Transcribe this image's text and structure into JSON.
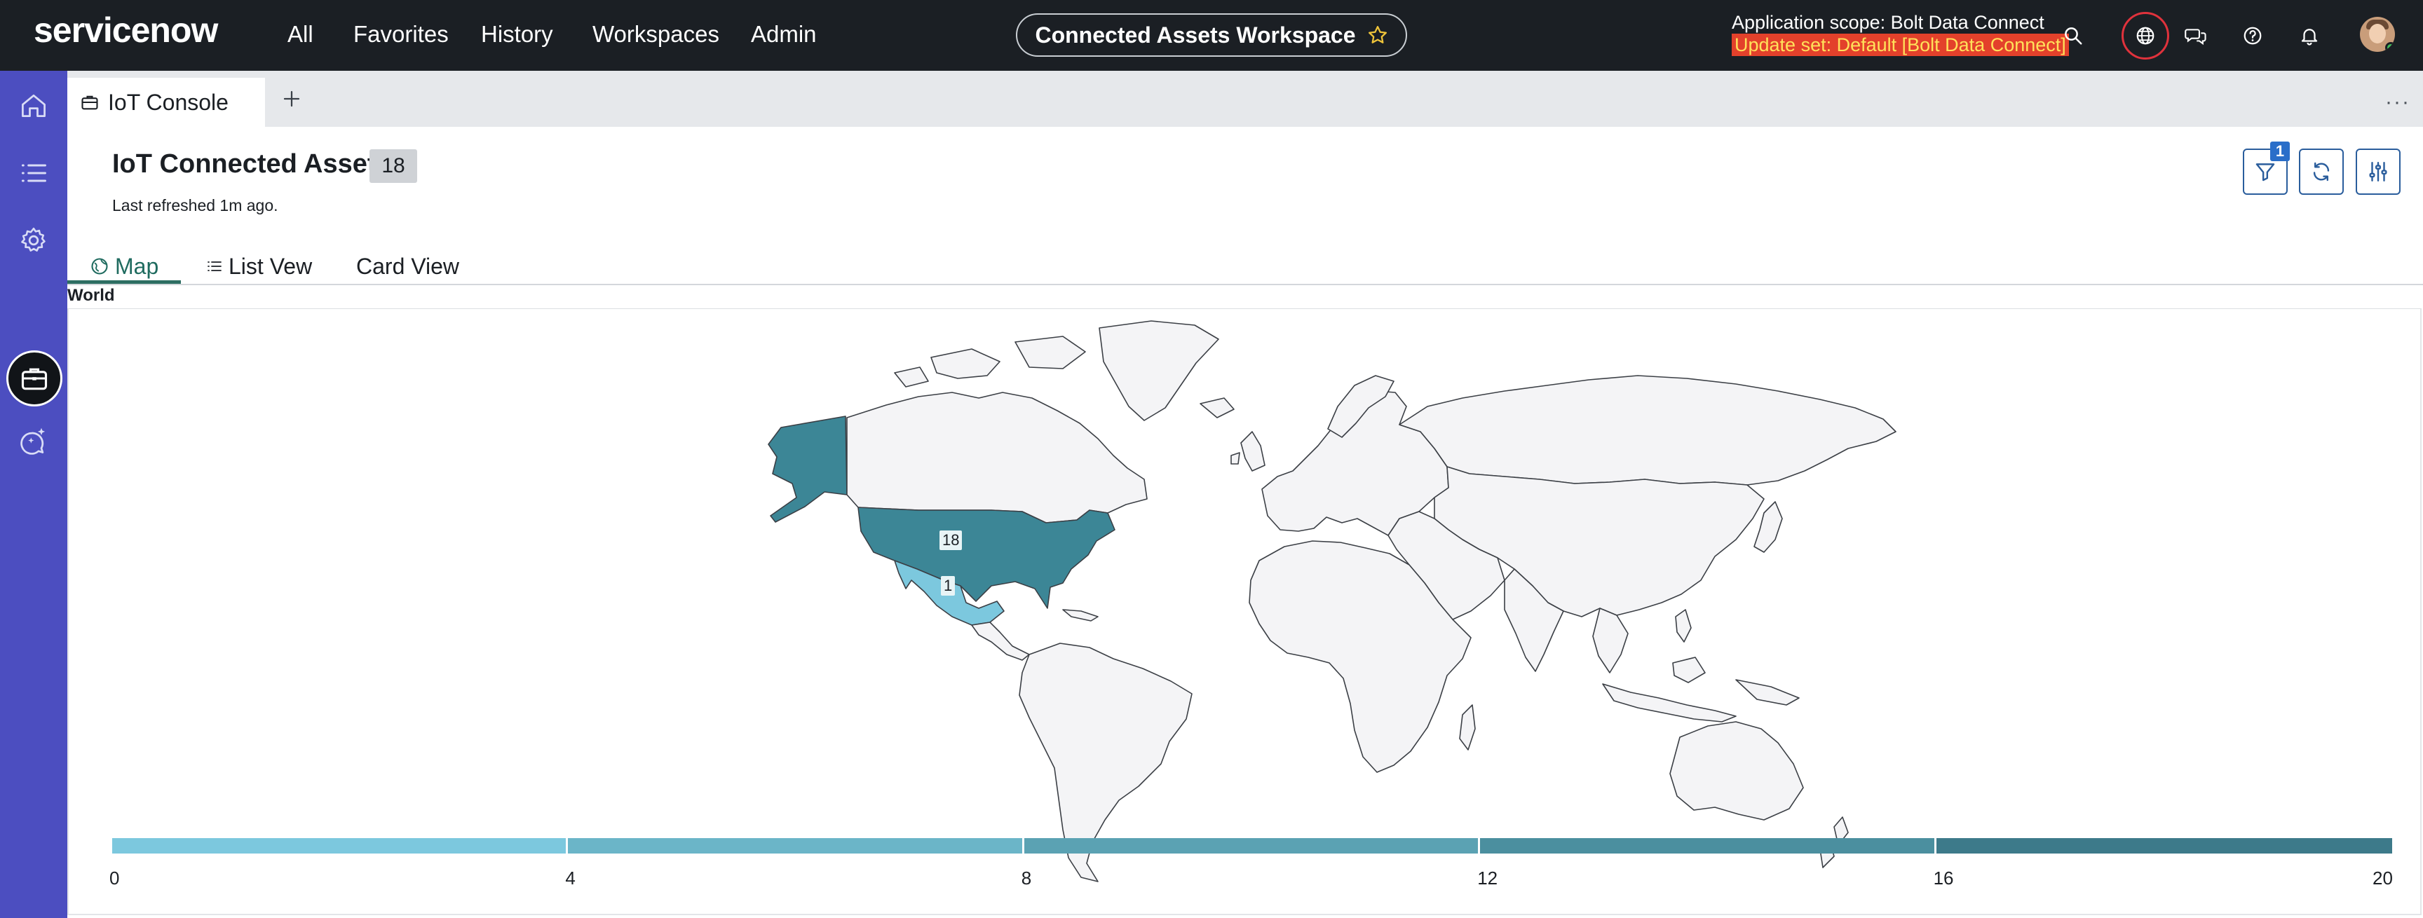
{
  "topbar": {
    "logo_text": "servicenow",
    "nav": [
      "All",
      "Favorites",
      "History",
      "Workspaces",
      "Admin"
    ],
    "workspace_title": "Connected Assets Workspace",
    "scope_line": "Application scope: Bolt Data Connect",
    "update_set_line": "Update set: Default [Bolt Data Connect]",
    "icons": [
      "search-icon",
      "globe-icon",
      "chat-icon",
      "help-icon",
      "bell-icon",
      "avatar"
    ]
  },
  "rail": {
    "icons": [
      "home-icon",
      "list-icon",
      "gear-icon",
      "briefcase-icon",
      "sparkle-chat-icon"
    ],
    "active": "briefcase-icon"
  },
  "tabs": {
    "active_label": "IoT Console",
    "more_label": "···"
  },
  "header": {
    "title": "IoT Connected Asset",
    "count": "18",
    "refreshed": "Last refreshed 1m ago.",
    "filter_count": "1"
  },
  "view_tabs": [
    {
      "label": "Map",
      "active": true
    },
    {
      "label": "List Vew",
      "active": false
    },
    {
      "label": "Card View",
      "active": false
    }
  ],
  "map": {
    "title": "World",
    "regions": [
      {
        "name": "United States",
        "value": 18,
        "color": "#3c8696"
      },
      {
        "name": "Mexico",
        "value": 1,
        "color": "#7cc8de"
      }
    ],
    "default_fill": "#f4f4f6",
    "stroke": "#3b3f45",
    "legend": {
      "ticks": [
        "0",
        "4",
        "8",
        "12",
        "16",
        "20"
      ],
      "colors": [
        "#7cc8de",
        "#6bb5c8",
        "#5ba2b3",
        "#4b8f9f",
        "#3d7a8a"
      ]
    }
  }
}
